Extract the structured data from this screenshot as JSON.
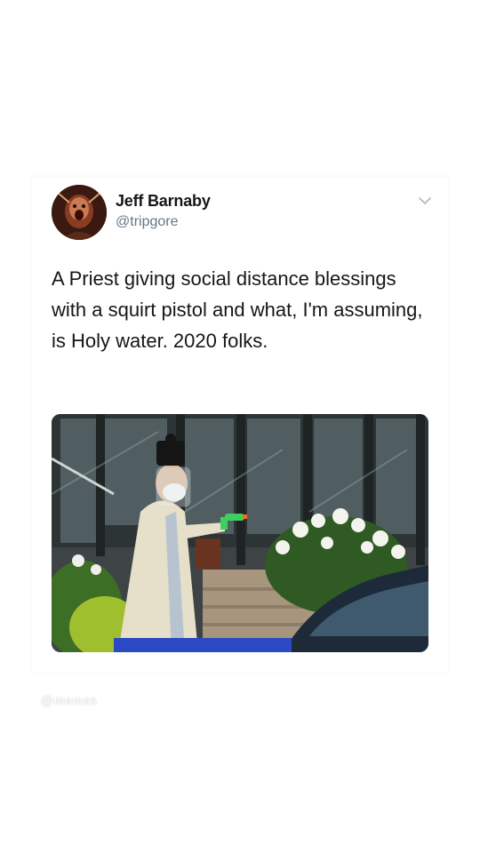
{
  "tweet": {
    "display_name": "Jeff Barnaby",
    "handle": "@tripgore",
    "text": "A Priest giving social distance blessings with a squirt pistol and what, I'm assuming, is Holy water. 2020 folks.",
    "menu_icon": "chevron-down-icon",
    "avatar": "profile-photo"
  },
  "media": {
    "subject": "priest-with-squirt-gun-photo"
  },
  "watermark": {
    "text": "@memes"
  },
  "colors": {
    "text_primary": "#14171a",
    "text_secondary": "#657786",
    "background": "#ffffff"
  }
}
